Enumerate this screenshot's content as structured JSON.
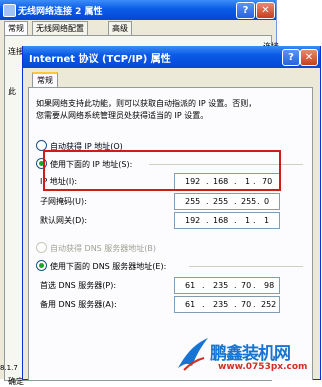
{
  "background_window": {
    "title": "无线网络连接 2 属性",
    "tabs": [
      "常规",
      "无线网络配置",
      "高级"
    ],
    "fragments": [
      "连接时使用",
      "连接",
      "此",
      "确定",
      "8.1.7"
    ]
  },
  "dialog": {
    "title": "Internet 协议 (TCP/IP) 属性",
    "help_label": "?",
    "close_label": "✕",
    "tab": "常规",
    "description": [
      "如果网络支持此功能，则可以获取自动指派的 IP 设置。否则，",
      "您需要从网络系统管理员处获得适当的 IP 设置。"
    ],
    "auto_ip_label": "自动获得 IP 地址(O)",
    "manual_ip_label": "使用下面的 IP 地址(S):",
    "ip_fields": [
      {
        "label": "IP 地址(I):",
        "octets": [
          "192",
          "168",
          "1",
          "70"
        ]
      },
      {
        "label": "子网掩码(U):",
        "octets": [
          "255",
          "255",
          "255",
          "0"
        ]
      },
      {
        "label": "默认网关(D):",
        "octets": [
          "192",
          "168",
          "1",
          "1"
        ]
      }
    ],
    "auto_dns_label": "自动获得 DNS 服务器地址(B)",
    "manual_dns_label": "使用下面的 DNS 服务器地址(E):",
    "dns_fields": [
      {
        "label": "首选 DNS 服务器(P):",
        "octets": [
          "61",
          "235",
          "70",
          "98"
        ]
      },
      {
        "label": "备用 DNS 服务器(A):",
        "octets": [
          "61",
          "235",
          "70",
          "252"
        ]
      }
    ],
    "selected_ip_mode": "manual",
    "selected_dns_mode": "manual"
  },
  "watermark": {
    "brand": "鹏鑫装机网",
    "url": "www.0753px.com"
  },
  "colors": {
    "titlebar": "#0a5ce6",
    "highlight_box": "#d01b1b",
    "watermark_blue": "#1874d2",
    "watermark_red": "#d03020"
  }
}
